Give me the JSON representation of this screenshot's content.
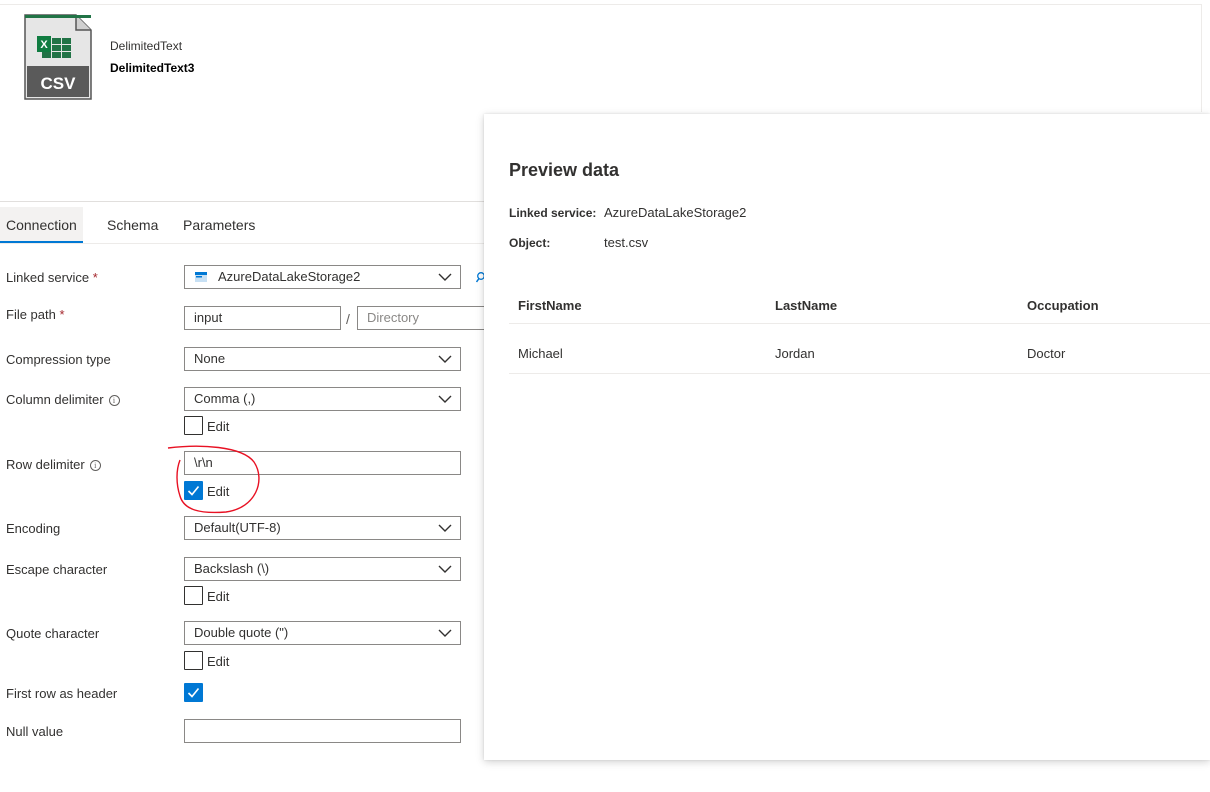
{
  "dataset": {
    "type": "DelimitedText",
    "name": "DelimitedText3",
    "icon": "csv-file-icon",
    "icon_text": "CSV"
  },
  "tabs": [
    {
      "label": "Connection",
      "active": true
    },
    {
      "label": "Schema",
      "active": false
    },
    {
      "label": "Parameters",
      "active": false
    }
  ],
  "form": {
    "linked_service": {
      "label": "Linked service",
      "required": "*",
      "value": "AzureDataLakeStorage2"
    },
    "file_path": {
      "label": "File path",
      "required": "*",
      "container": "input",
      "directory_placeholder": "Directory",
      "separator": "/"
    },
    "compression_type": {
      "label": "Compression type",
      "value": "None"
    },
    "column_delimiter": {
      "label": "Column delimiter",
      "value": "Comma (,)",
      "edit_label": "Edit",
      "edit_checked": false
    },
    "row_delimiter": {
      "label": "Row delimiter",
      "value": "\\r\\n",
      "edit_label": "Edit",
      "edit_checked": true
    },
    "encoding": {
      "label": "Encoding",
      "value": "Default(UTF-8)"
    },
    "escape_character": {
      "label": "Escape character",
      "value": "Backslash (\\)",
      "edit_label": "Edit",
      "edit_checked": false
    },
    "quote_character": {
      "label": "Quote character",
      "value": "Double quote (\")",
      "edit_label": "Edit",
      "edit_checked": false
    },
    "first_row_header": {
      "label": "First row as header",
      "checked": true
    },
    "null_value": {
      "label": "Null value",
      "value": ""
    }
  },
  "preview": {
    "title": "Preview data",
    "linked_service_label": "Linked service:",
    "linked_service_value": "AzureDataLakeStorage2",
    "object_label": "Object:",
    "object_value": "test.csv",
    "columns": [
      "FirstName",
      "LastName",
      "Occupation"
    ],
    "rows": [
      [
        "Michael",
        "Jordan",
        "Doctor"
      ]
    ]
  },
  "colors": {
    "accent": "#0078d4",
    "annotation": "#e81123",
    "csv_green": "#217346"
  }
}
